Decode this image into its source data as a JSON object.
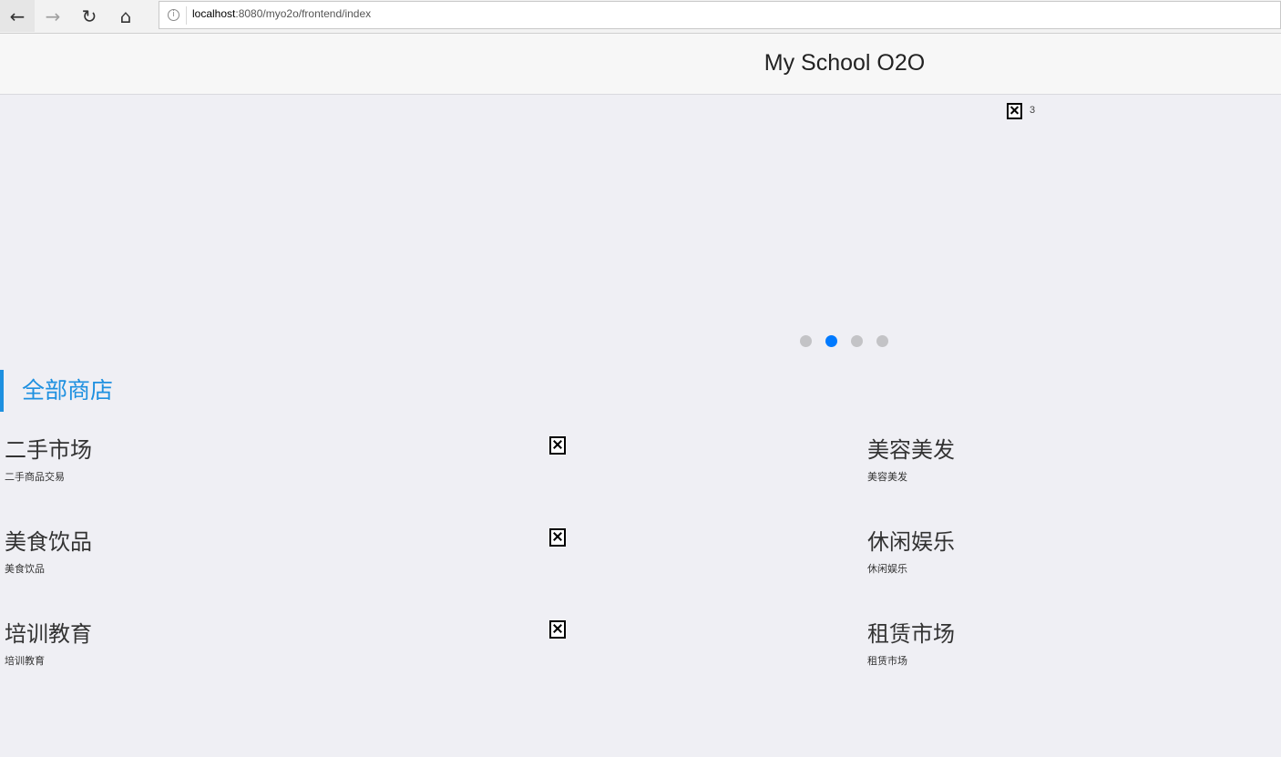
{
  "browser": {
    "back_icon": "←",
    "forward_icon": "→",
    "reload_icon": "↻",
    "home_icon": "⌂",
    "info_icon": "i",
    "url_host": "localhost",
    "url_path": ":8080/myo2o/frontend/index"
  },
  "header": {
    "title": "My School O2O"
  },
  "banner": {
    "image_alt": "3",
    "dots": [
      {
        "active": false
      },
      {
        "active": true
      },
      {
        "active": false
      },
      {
        "active": false
      }
    ]
  },
  "section": {
    "title": "全部商店"
  },
  "categories": [
    {
      "name": "二手市场",
      "desc": "二手商品交易"
    },
    {
      "name": "美容美发",
      "desc": "美容美发"
    },
    {
      "name": "美食饮品",
      "desc": "美食饮品"
    },
    {
      "name": "休闲娱乐",
      "desc": "休闲娱乐"
    },
    {
      "name": "培训教育",
      "desc": "培训教育"
    },
    {
      "name": "租赁市场",
      "desc": "租赁市场"
    }
  ],
  "colors": {
    "accent": "#1e90e0",
    "active_dot": "#007aff",
    "background": "#efeff4"
  }
}
